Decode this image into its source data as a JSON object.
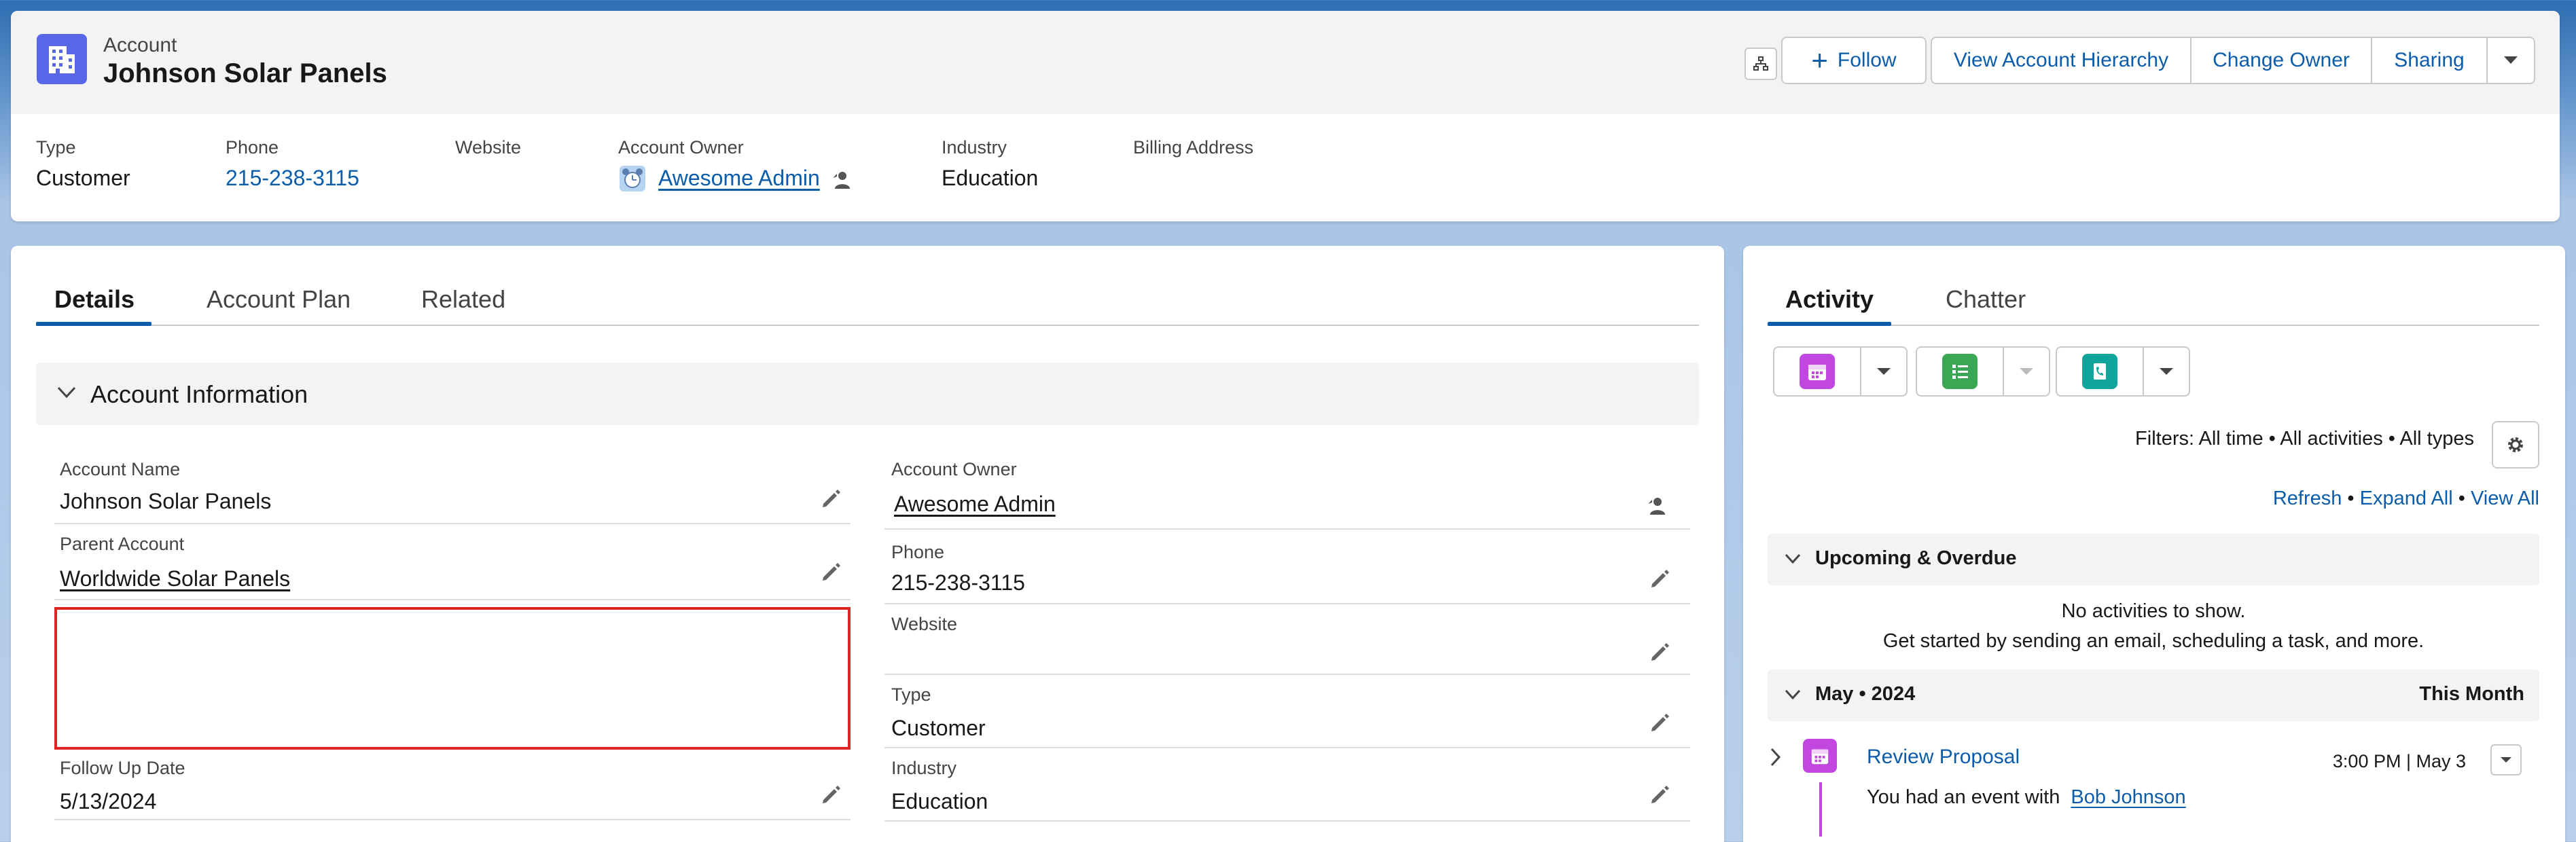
{
  "header": {
    "object_type": "Account",
    "title": "Johnson Solar Panels",
    "follow_label": "Follow",
    "actions": [
      "View Account Hierarchy",
      "Change Owner",
      "Sharing"
    ],
    "highlights": {
      "type_label": "Type",
      "type_value": "Customer",
      "phone_label": "Phone",
      "phone_value": "215-238-3115",
      "website_label": "Website",
      "website_value": "",
      "owner_label": "Account Owner",
      "owner_value": "Awesome Admin",
      "industry_label": "Industry",
      "industry_value": "Education",
      "billing_label": "Billing Address",
      "billing_value": ""
    }
  },
  "details": {
    "tabs": [
      "Details",
      "Account Plan",
      "Related"
    ],
    "section_title": "Account Information",
    "left_fields": {
      "account_name_label": "Account Name",
      "account_name_value": "Johnson Solar Panels",
      "parent_label": "Parent Account",
      "parent_value": "Worldwide Solar Panels",
      "follow_up_label": "Follow Up Date",
      "follow_up_value": "5/13/2024"
    },
    "right_fields": {
      "owner_label": "Account Owner",
      "owner_value": "Awesome Admin",
      "phone_label": "Phone",
      "phone_value": "215-238-3115",
      "website_label": "Website",
      "website_value": "",
      "type_label": "Type",
      "type_value": "Customer",
      "industry_label": "Industry",
      "industry_value": "Education"
    }
  },
  "activity": {
    "tabs": [
      "Activity",
      "Chatter"
    ],
    "filters_text": "Filters: All time • All activities • All types",
    "refresh": "Refresh",
    "expand_all": "Expand All",
    "view_all": "View All",
    "bullet": "•",
    "upcoming_title": "Upcoming & Overdue",
    "empty_line1": "No activities to show.",
    "empty_line2": "Get started by sending an email, scheduling a task, and more.",
    "month_title": "May • 2024",
    "month_right": "This Month",
    "event_title": "Review Proposal",
    "event_time": "3:00 PM | May 3",
    "event_desc": "You had an event with",
    "event_person": "Bob Johnson"
  },
  "colors": {
    "brand_blue": "#0b5cab",
    "account_icon": "#5867e8",
    "event_purple": "#c246e0",
    "task_green": "#3ba755",
    "call_teal": "#0d9dda",
    "highlight_red": "#e02525"
  }
}
